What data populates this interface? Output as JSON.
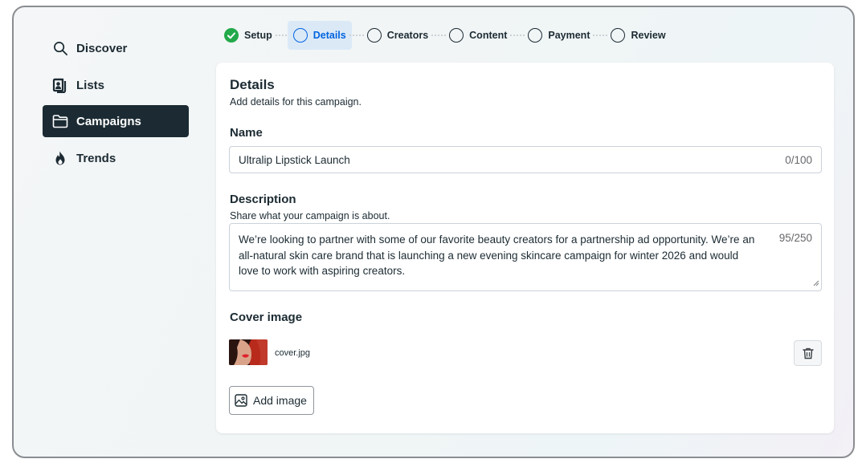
{
  "sidebar": {
    "items": [
      {
        "label": "Discover",
        "icon": "search-icon",
        "active": false
      },
      {
        "label": "Lists",
        "icon": "lists-icon",
        "active": false
      },
      {
        "label": "Campaigns",
        "icon": "folder-icon",
        "active": true
      },
      {
        "label": "Trends",
        "icon": "flame-icon",
        "active": false
      }
    ]
  },
  "stepper": {
    "steps": [
      {
        "label": "Setup",
        "state": "done"
      },
      {
        "label": "Details",
        "state": "active"
      },
      {
        "label": "Creators",
        "state": "todo"
      },
      {
        "label": "Content",
        "state": "todo"
      },
      {
        "label": "Payment",
        "state": "todo"
      },
      {
        "label": "Review",
        "state": "todo"
      }
    ]
  },
  "details": {
    "title": "Details",
    "subtitle": "Add details for this campaign.",
    "name": {
      "label": "Name",
      "value": "Ultralip Lipstick Launch",
      "counter": "0/100"
    },
    "description": {
      "label": "Description",
      "help": "Share what your campaign is about.",
      "value": "We’re looking to partner with some of our favorite beauty creators for a partnership ad opportunity. We’re an all-natural skin care brand that is launching a new evening skincare campaign for winter 2026 and would love to work with aspiring creators.",
      "counter": "95/250"
    },
    "cover": {
      "label": "Cover image",
      "filename": "cover.jpg",
      "add_label": "Add image",
      "delete_icon": "trash-icon",
      "add_icon": "image-icon"
    }
  },
  "colors": {
    "accent": "#0064e0",
    "success": "#23a94a",
    "nav_active_bg": "#1c2b33",
    "step_active_bg": "#dbe9f7"
  }
}
